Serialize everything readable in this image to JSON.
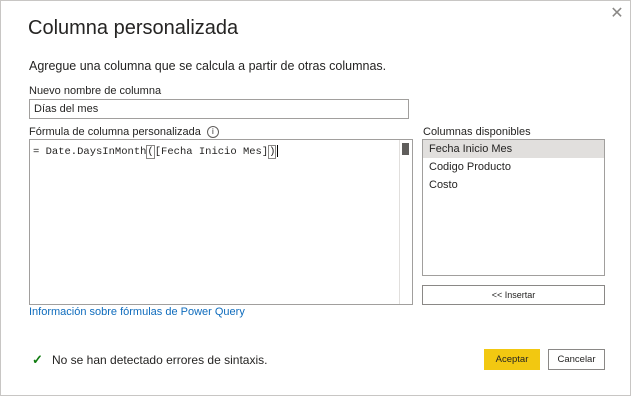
{
  "dialog": {
    "title": "Columna personalizada",
    "subtitle": "Agregue una columna que se calcula a partir de otras columnas.",
    "close_icon": "close-icon"
  },
  "name_field": {
    "label": "Nuevo nombre de columna",
    "value": "Días del mes"
  },
  "formula": {
    "label": "Fórmula de columna personalizada",
    "info_icon": "info-icon",
    "prefix": "= Date.DaysInMonth",
    "paren_open": "(",
    "argument": "[Fecha Inicio Mes]",
    "paren_close": ")"
  },
  "columns": {
    "label": "Columnas disponibles",
    "items": [
      "Fecha Inicio Mes",
      "Codigo Producto",
      "Costo"
    ],
    "selected": "Fecha Inicio Mes",
    "insert_label": "<< Insertar"
  },
  "help_link": "Información sobre fórmulas de Power Query",
  "status": {
    "icon": "checkmark-icon",
    "text": "No se han detectado errores de sintaxis."
  },
  "buttons": {
    "ok": "Aceptar",
    "cancel": "Cancelar"
  },
  "colors": {
    "accent": "#f2c811",
    "link": "#0f6cbd",
    "success": "#107c10"
  }
}
